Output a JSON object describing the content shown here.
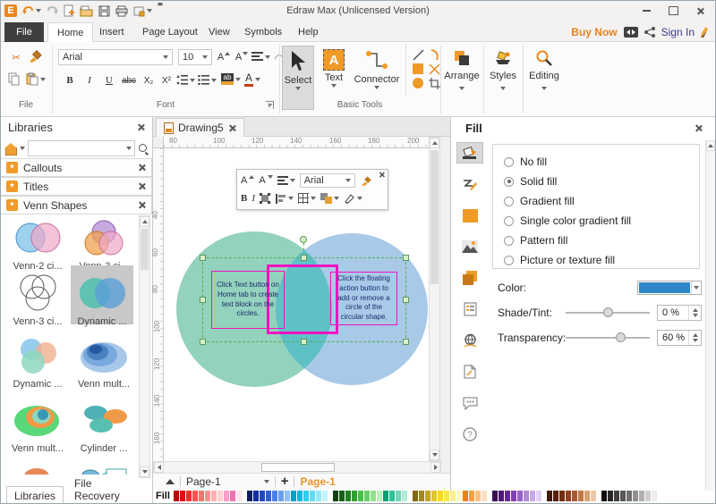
{
  "window": {
    "title": "Edraw Max (Unlicensed Version)",
    "logo_letter": "E"
  },
  "menu": {
    "file_tab": "File",
    "tabs": [
      "Home",
      "Insert",
      "Page Layout",
      "View",
      "Symbols",
      "Help"
    ],
    "active_tab": "Home",
    "buy_now": "Buy Now",
    "sign_in": "Sign In"
  },
  "ribbon": {
    "font_name": "Arial",
    "font_size": "10",
    "font_icons": {
      "bold": "B",
      "italic": "I",
      "underline": "U",
      "strike": "abc",
      "subscript": "X₂",
      "superscript": "X²",
      "font_color": "A",
      "grow": "A",
      "shrink": "A"
    },
    "tools": {
      "select": "Select",
      "text": "Text",
      "text_icon": "A",
      "connector": "Connector"
    },
    "buttons": {
      "arrange": "Arrange",
      "styles": "Styles",
      "editing": "Editing"
    },
    "group_labels": {
      "file": "File",
      "font": "Font",
      "basic_tools": "Basic Tools"
    }
  },
  "libraries": {
    "title": "Libraries",
    "sections": [
      "Callouts",
      "Titles",
      "Venn Shapes"
    ],
    "shapes": [
      {
        "label": "Venn-2 ci..."
      },
      {
        "label": "Venn-3 ci..."
      },
      {
        "label": "Venn-3 ci..."
      },
      {
        "label": "Dynamic ...",
        "selected": true
      },
      {
        "label": "Dynamic ..."
      },
      {
        "label": "Venn mult..."
      },
      {
        "label": "Venn mult..."
      },
      {
        "label": "Cylinder ..."
      }
    ],
    "bottom_tabs": [
      "Libraries",
      "File Recovery"
    ]
  },
  "canvas": {
    "doc_tab": "Drawing5",
    "h_ruler": [
      "80",
      "100",
      "120",
      "140",
      "160",
      "180",
      "200"
    ],
    "v_ruler": [
      "40",
      "60",
      "80",
      "100",
      "120",
      "140",
      "160"
    ],
    "floating_toolbar": {
      "font_name": "Arial",
      "bold": "B",
      "italic": "I",
      "grow": "A",
      "shrink": "A"
    },
    "venn": {
      "left_text": "Click Text button on Home tab to create text block on the circles.",
      "right_text": "Click the floating action button to add or remove a circle of the circular shape.",
      "left_color": "#93d2bd",
      "right_color": "#a9c9e8",
      "overlap_color": "#5fc0c6",
      "selection_color": "#52b152",
      "highlight_color": "#f012c0"
    },
    "pages": {
      "dropdown_label": "Page-1",
      "active_page": "Page-1"
    }
  },
  "fill_panel": {
    "title": "Fill",
    "options": [
      "No fill",
      "Solid fill",
      "Gradient fill",
      "Single color gradient fill",
      "Pattern fill",
      "Picture or texture fill"
    ],
    "selected_option": "Solid fill",
    "color_label": "Color:",
    "color_value": "#2e86c8",
    "shade_label": "Shade/Tint:",
    "shade_value": "0 %",
    "transparency_label": "Transparency:",
    "transparency_value": "60 %"
  },
  "status": {
    "fill_label": "Fill"
  },
  "palette": {
    "groups": [
      [
        "#c00000",
        "#e01010",
        "#f03030",
        "#ff5050",
        "#ff7070",
        "#ff9090",
        "#ffb0b0",
        "#ffd0d0",
        "#f8a0c8",
        "#f070b0",
        "#fce4f0"
      ],
      [
        "#102060",
        "#1030a0",
        "#2048c0",
        "#3060d8",
        "#4880e8",
        "#68a0f0",
        "#90c0f8",
        "#00a0c8",
        "#00b8dc",
        "#30ccec",
        "#60dcf4",
        "#90e8f8",
        "#c0f4fc"
      ],
      [
        "#104010",
        "#186018",
        "#208020",
        "#30a030",
        "#48c048",
        "#68d068",
        "#90e090",
        "#b8f0b8",
        "#00a078",
        "#30c098",
        "#70d8b8",
        "#b0ecd8"
      ],
      [
        "#806810",
        "#a08820",
        "#c0a820",
        "#e0c820",
        "#f8d820",
        "#f8e450",
        "#f8f090",
        "#fcf8c8",
        "#f08010",
        "#f8a040",
        "#f8c080",
        "#fce0c0"
      ],
      [
        "#381058",
        "#501878",
        "#682898",
        "#8040b0",
        "#9860c8",
        "#b088d8",
        "#c8a8e8",
        "#e0d0f4"
      ],
      [
        "#401808",
        "#582008",
        "#703010",
        "#904020",
        "#a85830",
        "#c07848",
        "#d8a070",
        "#ecc8a8"
      ],
      [
        "#101010",
        "#282828",
        "#404040",
        "#585858",
        "#707070",
        "#909090",
        "#b0b0b0",
        "#d0d0d0",
        "#ececec"
      ]
    ]
  }
}
